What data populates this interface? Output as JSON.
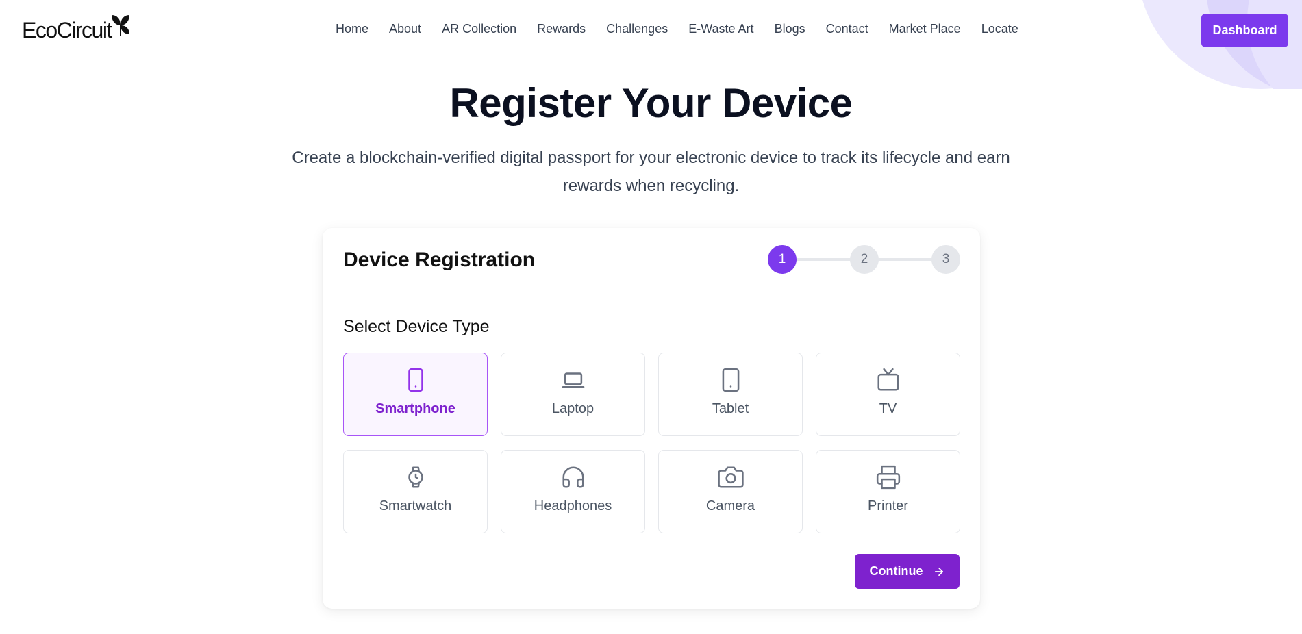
{
  "brand": {
    "logo_text": "EcoCircuit"
  },
  "nav": {
    "items": [
      "Home",
      "About",
      "AR Collection",
      "Rewards",
      "Challenges",
      "E-Waste Art",
      "Blogs",
      "Contact",
      "Market Place",
      "Locate"
    ],
    "dashboard_label": "Dashboard"
  },
  "hero": {
    "title": "Register Your Device",
    "subtitle": "Create a blockchain-verified digital passport for your electronic device to track its lifecycle and earn rewards when recycling."
  },
  "registration": {
    "title": "Device Registration",
    "steps": [
      "1",
      "2",
      "3"
    ],
    "active_step": 1,
    "section_label": "Select Device Type",
    "device_types": [
      {
        "label": "Smartphone",
        "icon": "smartphone-icon",
        "selected": true
      },
      {
        "label": "Laptop",
        "icon": "laptop-icon",
        "selected": false
      },
      {
        "label": "Tablet",
        "icon": "tablet-icon",
        "selected": false
      },
      {
        "label": "TV",
        "icon": "tv-icon",
        "selected": false
      },
      {
        "label": "Smartwatch",
        "icon": "watch-icon",
        "selected": false
      },
      {
        "label": "Headphones",
        "icon": "headphones-icon",
        "selected": false
      },
      {
        "label": "Camera",
        "icon": "camera-icon",
        "selected": false
      },
      {
        "label": "Printer",
        "icon": "printer-icon",
        "selected": false
      }
    ],
    "continue_label": "Continue"
  },
  "colors": {
    "accent": "#7c3aed",
    "accent_dark": "#7e22ce",
    "selected_bg": "#faf5ff"
  }
}
